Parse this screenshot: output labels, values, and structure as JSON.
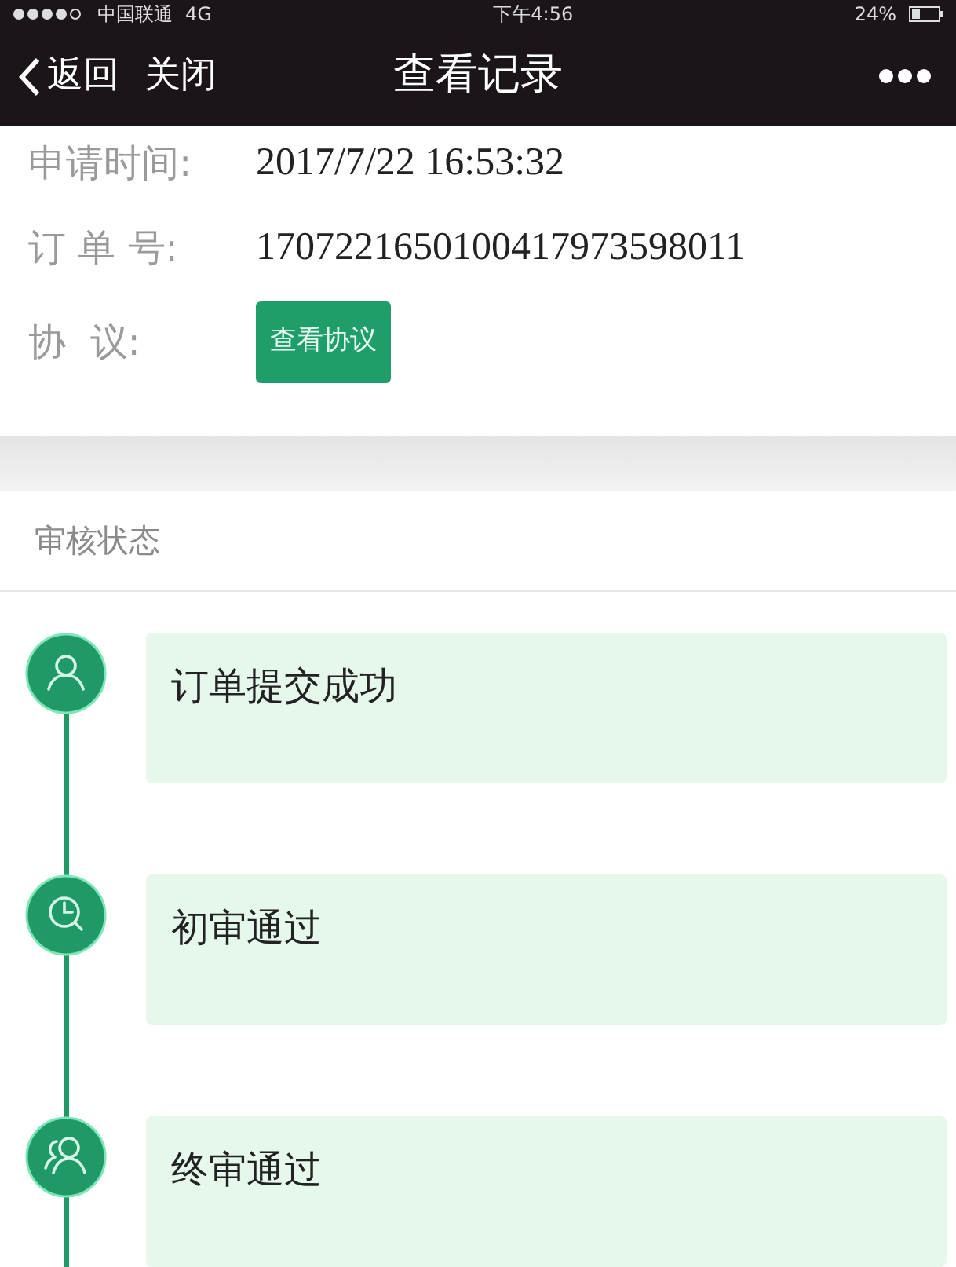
{
  "status_bar": {
    "carrier": "中国联通",
    "network": "4G",
    "time": "下午4:56",
    "battery": "24%"
  },
  "nav": {
    "back": "返回",
    "close": "关闭",
    "title": "查看记录"
  },
  "info": [
    {
      "kind": "text",
      "label": "申请时间:",
      "value": "2017/7/22 16:53:32"
    },
    {
      "kind": "text",
      "label": "订 单 号:",
      "value": "1707221650100417973598011"
    },
    {
      "kind": "button",
      "label": "协  议:",
      "value": "查看协议"
    }
  ],
  "review": {
    "title": "审核状态",
    "steps": [
      {
        "kind": "person",
        "label": "订单提交成功"
      },
      {
        "kind": "clock",
        "label": "初审通过"
      },
      {
        "kind": "people",
        "label": "终审通过"
      }
    ]
  }
}
